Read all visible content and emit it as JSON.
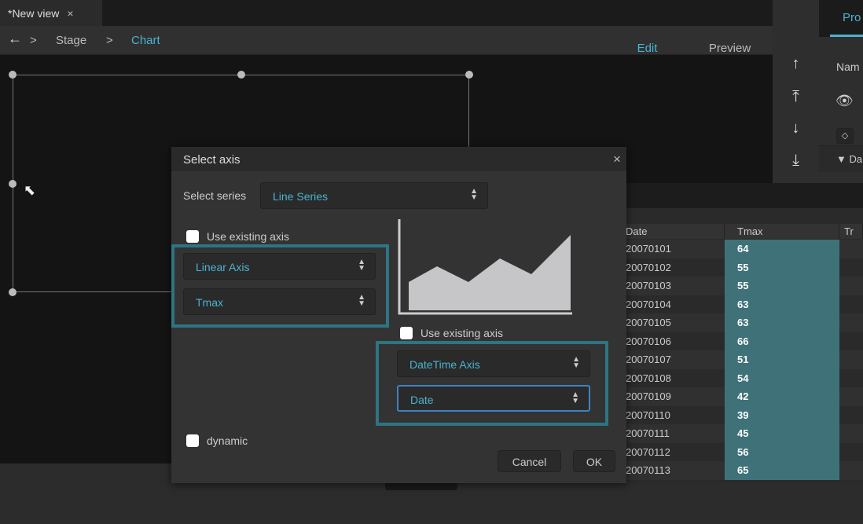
{
  "tab": {
    "title": "*New view",
    "close": "×"
  },
  "breadcrumb": {
    "back": "←",
    "sep": ">",
    "stage": "Stage",
    "chart": "Chart"
  },
  "modes": {
    "edit": "Edit",
    "preview": "Preview",
    "active": "Edit"
  },
  "toolbar": {
    "up": "↑",
    "top": "⤒",
    "down": "↓",
    "bottom": "⤓"
  },
  "props": {
    "tab": "Pro",
    "name_label": "Nam",
    "section": "▼ Da"
  },
  "table": {
    "headers": [
      "Date",
      "Tmax",
      "Tr"
    ],
    "rows": [
      [
        "20070101",
        "64"
      ],
      [
        "20070102",
        "55"
      ],
      [
        "20070103",
        "55"
      ],
      [
        "20070104",
        "63"
      ],
      [
        "20070105",
        "63"
      ],
      [
        "20070106",
        "66"
      ],
      [
        "20070107",
        "51"
      ],
      [
        "20070108",
        "54"
      ],
      [
        "20070109",
        "42"
      ],
      [
        "20070110",
        "39"
      ],
      [
        "20070111",
        "45"
      ],
      [
        "20070112",
        "56"
      ],
      [
        "20070113",
        "65"
      ]
    ]
  },
  "dialog": {
    "title": "Select axis",
    "close": "×",
    "series_label": "Select series",
    "series_value": "Line Series",
    "y": {
      "use_existing": "Use existing axis",
      "axis_type": "Linear Axis",
      "field": "Tmax"
    },
    "x": {
      "use_existing": "Use existing axis",
      "axis_type": "DateTime Axis",
      "field": "Date"
    },
    "dynamic": "dynamic",
    "cancel": "Cancel",
    "ok": "OK"
  },
  "colors": {
    "accent": "#4ab3cf",
    "highlight": "#2d7583",
    "selected_column": "#3f7179"
  }
}
